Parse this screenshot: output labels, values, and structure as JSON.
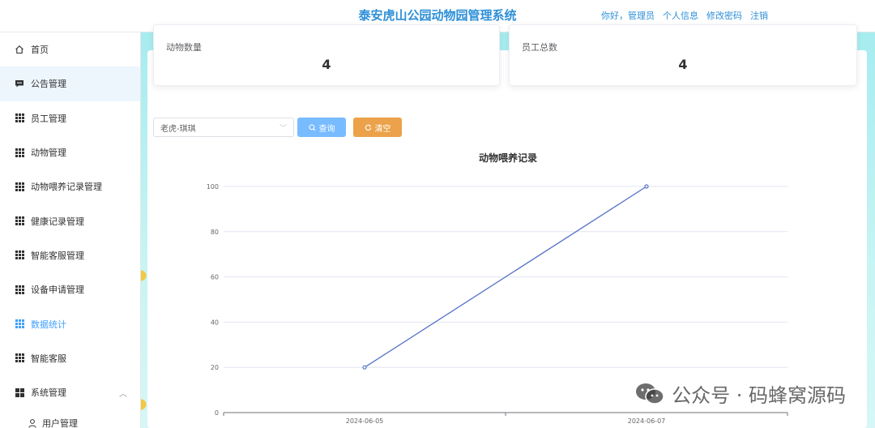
{
  "header": {
    "title": "泰安虎山公园动物园管理系统",
    "greeting": "你好，管理员",
    "profile_link": "个人信息",
    "change_password_link": "修改密码",
    "logout_link": "注销"
  },
  "sidebar": {
    "items": [
      {
        "label": "首页",
        "icon": "home-icon"
      },
      {
        "label": "公告管理",
        "icon": "comment-icon"
      },
      {
        "label": "员工管理",
        "icon": "grid-icon"
      },
      {
        "label": "动物管理",
        "icon": "grid-icon"
      },
      {
        "label": "动物喂养记录管理",
        "icon": "grid-icon"
      },
      {
        "label": "健康记录管理",
        "icon": "grid-icon"
      },
      {
        "label": "智能客服管理",
        "icon": "grid-icon"
      },
      {
        "label": "设备申请管理",
        "icon": "grid-icon"
      },
      {
        "label": "数据统计",
        "icon": "grid-icon"
      },
      {
        "label": "智能客服",
        "icon": "grid-icon"
      },
      {
        "label": "系统管理",
        "icon": "grid4-icon"
      }
    ],
    "sub_items": [
      {
        "label": "用户管理",
        "icon": "user-icon"
      }
    ],
    "colors": {
      "active_text": "#409eff",
      "active_bg": "#eef6fd"
    }
  },
  "stats": {
    "animal_count_label": "动物数量",
    "animal_count_value": "4",
    "staff_total_label": "员工总数",
    "staff_total_value": "4"
  },
  "filter": {
    "select_value": "老虎-琪琪",
    "search_label": "查询",
    "clear_label": "清空",
    "colors": {
      "search": "#79bbff",
      "clear": "#eba24a"
    }
  },
  "chart_data": {
    "type": "line",
    "title": "动物喂养记录",
    "categories": [
      "2024-06-05",
      "2024-06-07"
    ],
    "series": [
      {
        "values": [
          20,
          100
        ],
        "color": "#5470c6"
      }
    ],
    "ylim": [
      0,
      100
    ],
    "yticks": [
      "0",
      "20",
      "40",
      "60",
      "80",
      "100"
    ],
    "grid": true,
    "xlabel": "",
    "ylabel": ""
  },
  "watermark": {
    "text": "公众号 · 码蜂窝源码"
  }
}
